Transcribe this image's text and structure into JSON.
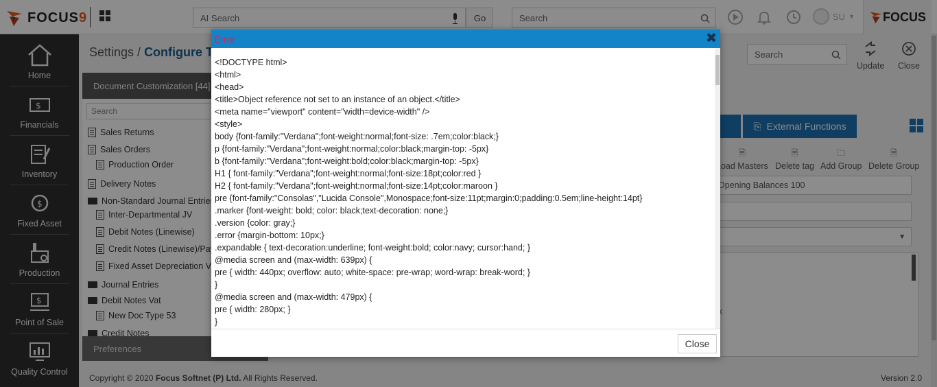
{
  "header": {
    "logo_text": "FOCUS",
    "logo_number": "9",
    "ai_search_placeholder": "AI Search",
    "go_label": "Go",
    "search_placeholder": "Search",
    "user_initials": "SU",
    "brand_text": "FOCUS"
  },
  "nav": [
    {
      "label": "Home",
      "icon": "home-icon"
    },
    {
      "label": "Financials",
      "icon": "financials-icon"
    },
    {
      "label": "Inventory",
      "icon": "inventory-icon"
    },
    {
      "label": "Fixed Asset",
      "icon": "fixed-asset-icon"
    },
    {
      "label": "Production",
      "icon": "production-icon"
    },
    {
      "label": "Point of Sale",
      "icon": "pos-icon"
    },
    {
      "label": "Quality Control",
      "icon": "quality-control-icon"
    }
  ],
  "page": {
    "breadcrumb_root": "Settings",
    "breadcrumb_sep": " / ",
    "breadcrumb_current": "Configure Tra",
    "left_panel_title": "Document Customization [44]",
    "left_search_placeholder": "Search",
    "tree": [
      {
        "label": "Sales Returns",
        "type": "list"
      },
      {
        "label": "Sales Orders",
        "type": "list"
      },
      {
        "label": "Production Order",
        "type": "doc"
      },
      {
        "label": "Delivery Notes",
        "type": "list"
      },
      {
        "label": "Non-Standard Journal Entries",
        "type": "folder"
      },
      {
        "label": "Inter-Departmental JV",
        "type": "doc"
      },
      {
        "label": "Debit Notes (Linewise)",
        "type": "doc"
      },
      {
        "label": "Credit Notes (Linewise)/Pay",
        "type": "doc"
      },
      {
        "label": "Fixed Asset Depreciation V",
        "type": "doc"
      },
      {
        "label": "Journal Entries",
        "type": "folder"
      },
      {
        "label": "Debit Notes Vat",
        "type": "folder"
      },
      {
        "label": "New Doc Type 53",
        "type": "doc"
      },
      {
        "label": "Credit Notes",
        "type": "folder"
      }
    ],
    "preferences_label": "Preferences",
    "right_search_placeholder": "Search",
    "update_label": "Update",
    "close_label": "Close",
    "external_functions_label": "External Functions",
    "toolbar": [
      "Load Masters",
      "Delete tag",
      "Add Group",
      "Delete Group"
    ],
    "field_value": "Opening Balances 100",
    "textarea_fragment": "k"
  },
  "footer": {
    "copyright_prefix": "Copyright © 2020 ",
    "company": "Focus Softnet (P) Ltd.",
    "copyright_suffix": " All Rights Reserved.",
    "version": "Version 2.0"
  },
  "dialog": {
    "title": "Error",
    "close_symbol": "✖",
    "close_button": "Close",
    "body_lines": [
      "<!DOCTYPE html>",
      "<html>",
      "<head>",
      "<title>Object reference not set to an instance of an object.</title>",
      "<meta name=\"viewport\" content=\"width=device-width\" />",
      "<style>",
      "body {font-family:\"Verdana\";font-weight:normal;font-size: .7em;color:black;}",
      "p {font-family:\"Verdana\";font-weight:normal;color:black;margin-top: -5px}",
      "b {font-family:\"Verdana\";font-weight:bold;color:black;margin-top: -5px}",
      "H1 { font-family:\"Verdana\";font-weight:normal;font-size:18pt;color:red }",
      "H2 { font-family:\"Verdana\";font-weight:normal;font-size:14pt;color:maroon }",
      "pre {font-family:\"Consolas\",\"Lucida Console\",Monospace;font-size:11pt;margin:0;padding:0.5em;line-height:14pt}",
      ".marker {font-weight: bold; color: black;text-decoration: none;}",
      ".version {color: gray;}",
      ".error {margin-bottom: 10px;}",
      ".expandable { text-decoration:underline; font-weight:bold; color:navy; cursor:hand; }",
      "@media screen and (max-width: 639px) {",
      "pre { width: 440px; overflow: auto; white-space: pre-wrap; word-wrap: break-word; }",
      "}",
      "@media screen and (max-width: 479px) {",
      "pre { width: 280px; }",
      "}"
    ]
  },
  "colors": {
    "nav_bg": "#2e2e2e",
    "accent_blue": "#1d72b3",
    "dialog_title_bg": "#1384c8",
    "error_red": "#e0204a",
    "brand_orange": "#e65c1c"
  }
}
